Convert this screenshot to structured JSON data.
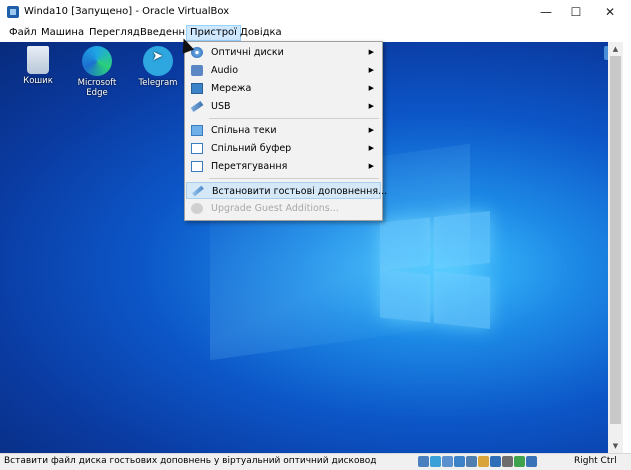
{
  "window": {
    "title": "Winda10 [Запущено] - Oracle VirtualBox",
    "minimize": "—",
    "maximize": "☐",
    "close": "✕"
  },
  "menubar": [
    {
      "label": "Файл"
    },
    {
      "label": "Машина"
    },
    {
      "label": "Перегляд"
    },
    {
      "label": "Введення"
    },
    {
      "label": "Пристрої",
      "active": true
    },
    {
      "label": "Довідка"
    }
  ],
  "desktop_icons": [
    {
      "label": "Кошик",
      "icon": "recycle-bin-icon"
    },
    {
      "label": "Microsoft Edge",
      "icon": "edge-icon"
    },
    {
      "label": "Telegram",
      "icon": "telegram-icon"
    }
  ],
  "devices_menu": {
    "items": [
      {
        "label": "Оптичні диски",
        "icon": "optical-disk-icon",
        "submenu": true
      },
      {
        "label": "Audio",
        "icon": "audio-icon",
        "submenu": true
      },
      {
        "label": "Мережа",
        "icon": "network-icon",
        "submenu": true
      },
      {
        "label": "USB",
        "icon": "usb-icon",
        "submenu": true
      },
      {
        "label": "Спільна теки",
        "icon": "shared-folders-icon",
        "submenu": true
      },
      {
        "label": "Спільний буфер",
        "icon": "shared-clipboard-icon",
        "submenu": true
      },
      {
        "label": "Перетягування",
        "icon": "drag-drop-icon",
        "submenu": true
      },
      {
        "label": "Встановити гостьові доповнення...",
        "icon": "guest-additions-icon",
        "highlighted": true
      },
      {
        "label": "Upgrade Guest Additions...",
        "icon": "upgrade-guest-additions-icon",
        "disabled": true
      }
    ]
  },
  "statusbar": {
    "text": "Вставити файл диска гостьових доповнень у віртуальний оптичний дисковод",
    "host_key": "Right Ctrl",
    "icons": [
      "hard-disk-icon",
      "optical-drive-icon",
      "audio-status-icon",
      "network-status-icon",
      "usb-status-icon",
      "shared-folder-status-icon",
      "display-status-icon",
      "recording-status-icon",
      "mouse-integration-icon",
      "keyboard-capture-icon"
    ],
    "icon_colors": [
      "#4a7fc0",
      "#3aa0d8",
      "#5a8fd0",
      "#3b82c8",
      "#4f7fb0",
      "#d9a53a",
      "#2e6fb8",
      "#6d6d6d",
      "#3fa34d",
      "#3a72b8"
    ]
  }
}
